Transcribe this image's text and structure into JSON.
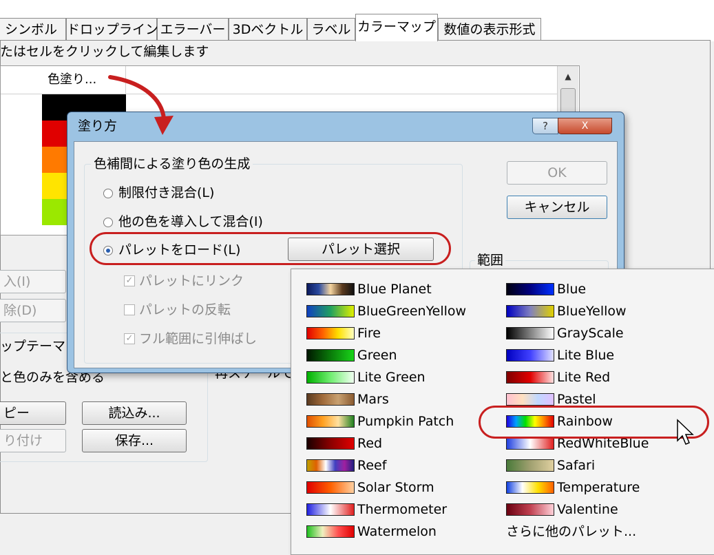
{
  "tabs": [
    "シンボル",
    "ドロップライン",
    "エラーバー",
    "3Dベクトル",
    "ラベル",
    "カラーマップ",
    "数値の表示形式"
  ],
  "hint": "たはセルをクリックして編集します",
  "grid": {
    "column_header": "色塗り..."
  },
  "left_buttons": {
    "insert": "入(I)",
    "delete": "除(D)"
  },
  "theme": {
    "label": "ップテーマ",
    "sub": "と色のみを含める"
  },
  "bottom_buttons": {
    "copy": "ピー",
    "load": "読込み...",
    "paste": "り付け",
    "save": "保存..."
  },
  "behind_dialog": {
    "range_label": "範囲",
    "scale_label": "再スケールで"
  },
  "dialog": {
    "title": "塗り方",
    "help": "?",
    "close": "X",
    "group_title": "色補間による塗り色の生成",
    "radios": [
      "制限付き混合(L)",
      "他の色を導入して混合(I)",
      "パレットをロード(L)"
    ],
    "select_palette_button": "パレット選択",
    "checkboxes": [
      {
        "label": "パレットにリンク",
        "checked": true
      },
      {
        "label": "パレットの反転",
        "checked": false
      },
      {
        "label": "フル範囲に引伸ばし",
        "checked": true
      }
    ],
    "ok": "OK",
    "cancel": "キャンセル"
  },
  "palettes_left": [
    "Blue Planet",
    "BlueGreenYellow",
    "Fire",
    "Green",
    "Lite Green",
    "Mars",
    "Pumpkin Patch",
    "Red",
    "Reef",
    "Solar Storm",
    "Thermometer",
    "Watermelon"
  ],
  "palettes_right": [
    "Blue",
    "BlueYellow",
    "GrayScale",
    "Lite Blue",
    "Lite Red",
    "Pastel",
    "Rainbow",
    "RedWhiteBlue",
    "Safari",
    "Temperature",
    "Valentine"
  ],
  "more_palettes": "さらに他のパレット...",
  "colors": {
    "annotation": "#c81f1f",
    "title_bar": "#9cc3e3"
  }
}
